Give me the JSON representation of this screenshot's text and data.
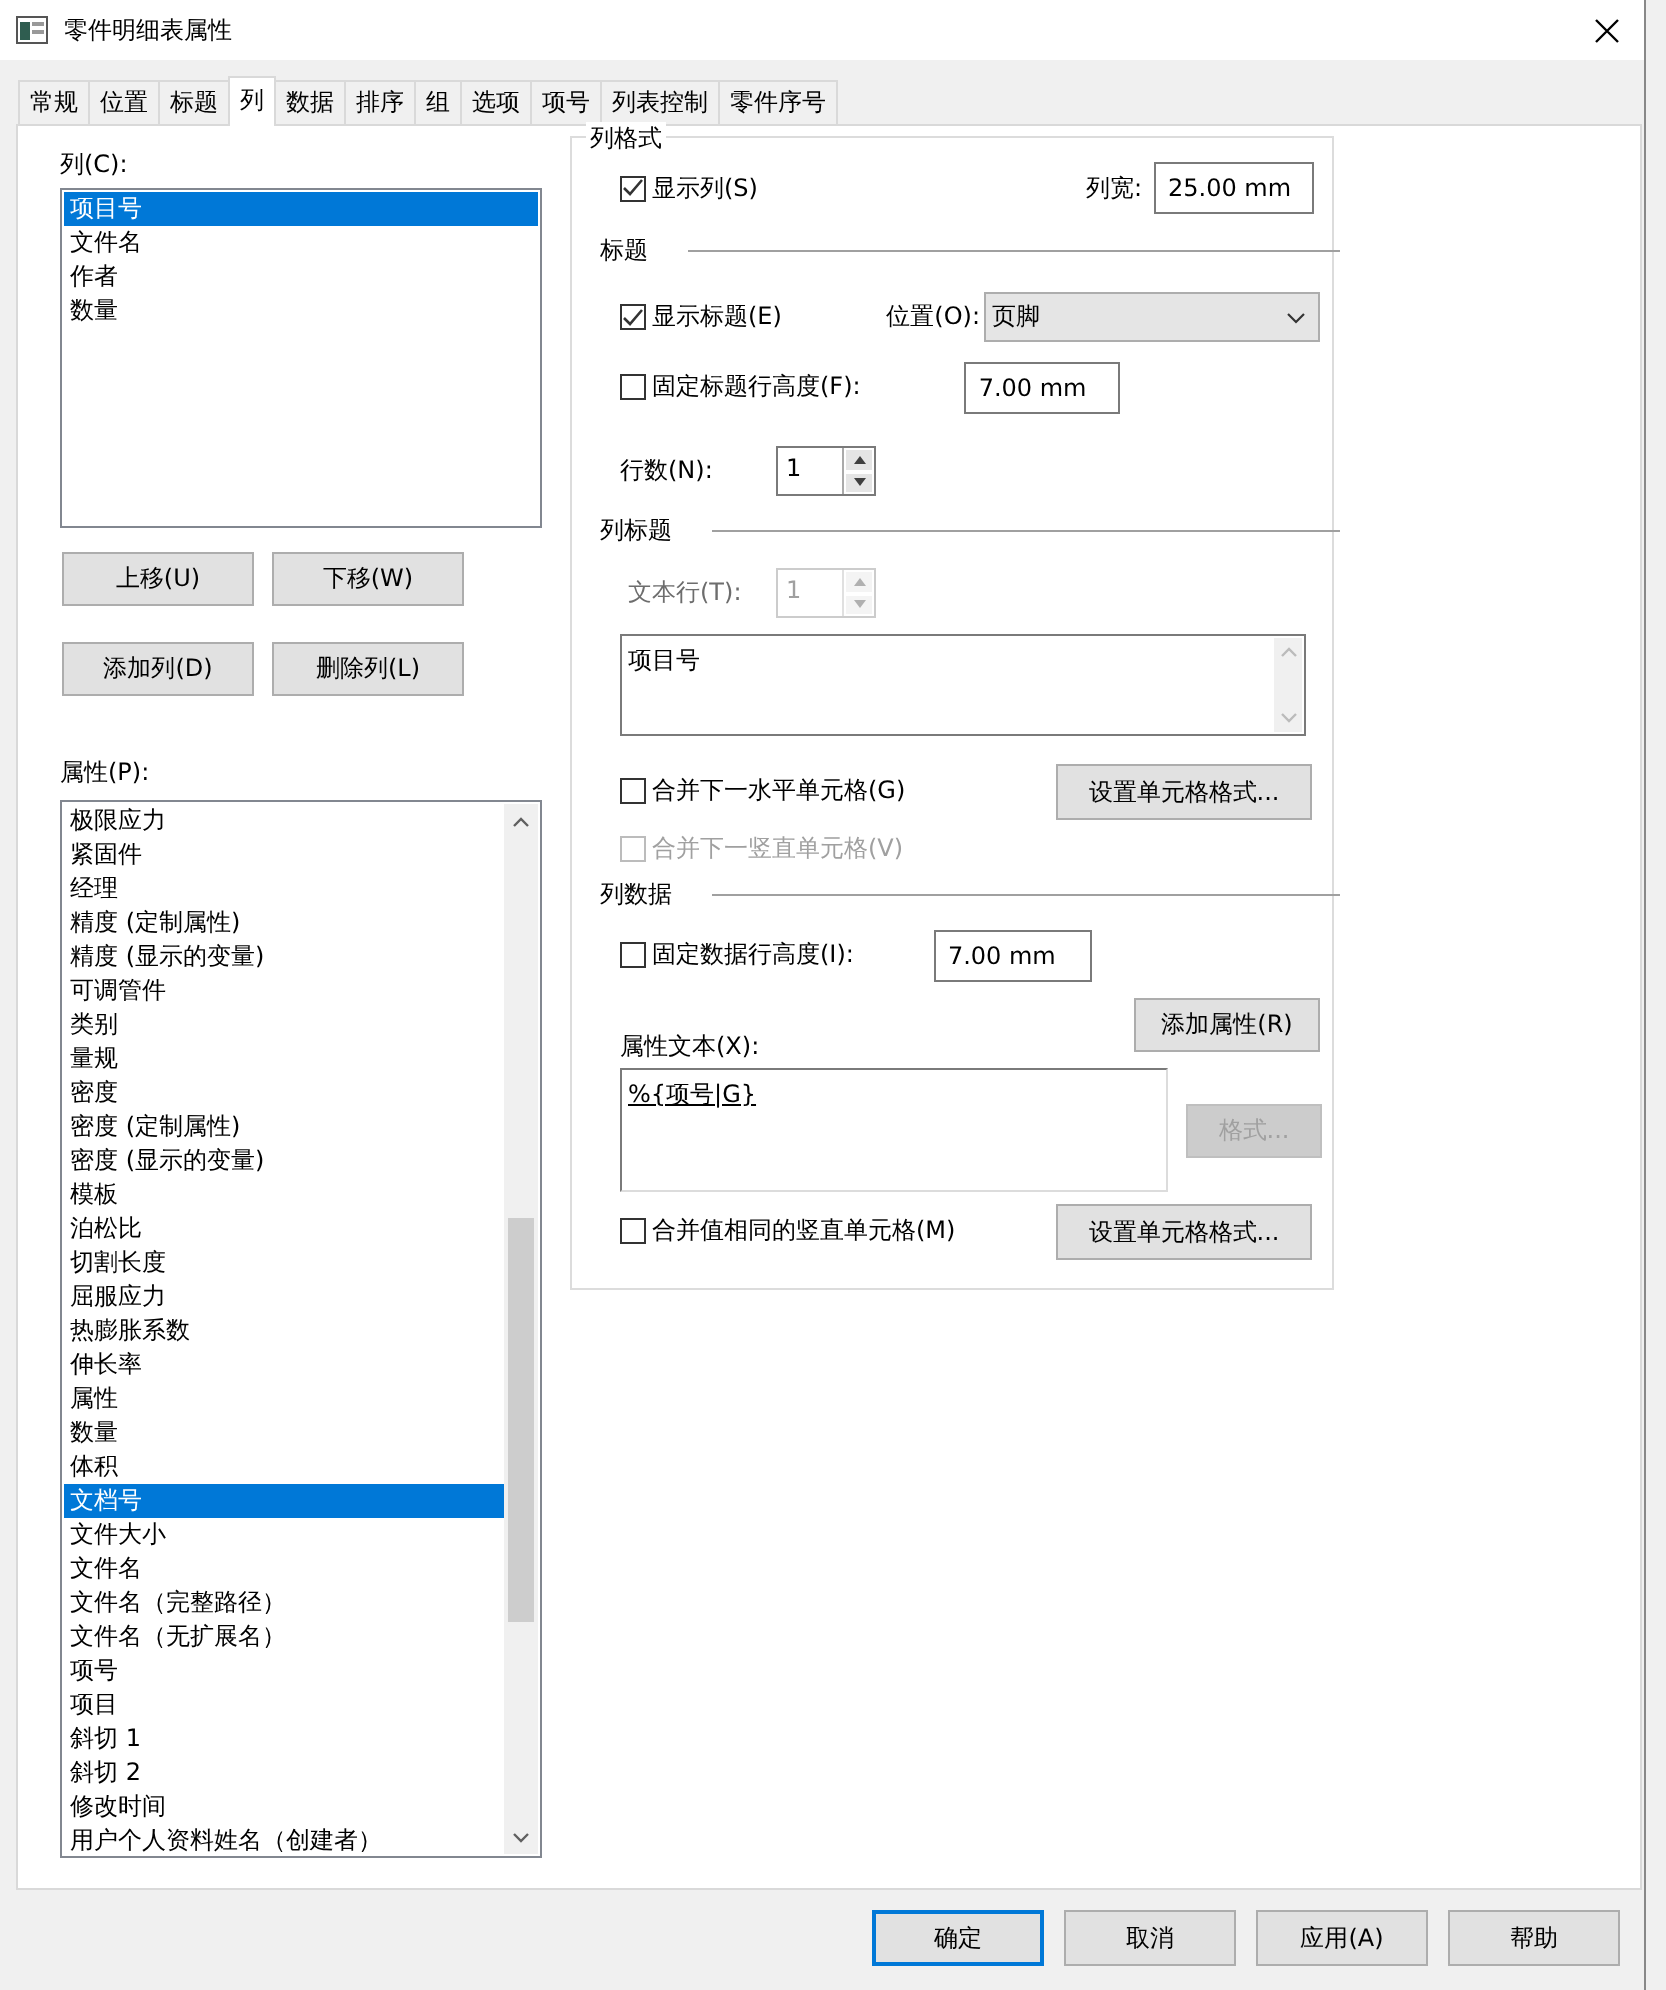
{
  "window": {
    "title": "零件明细表属性"
  },
  "tabs": [
    {
      "label": "常规",
      "selected": false
    },
    {
      "label": "位置",
      "selected": false
    },
    {
      "label": "标题",
      "selected": false
    },
    {
      "label": "列",
      "selected": true
    },
    {
      "label": "数据",
      "selected": false
    },
    {
      "label": "排序",
      "selected": false
    },
    {
      "label": "组",
      "selected": false
    },
    {
      "label": "选项",
      "selected": false
    },
    {
      "label": "项号",
      "selected": false
    },
    {
      "label": "列表控制",
      "selected": false
    },
    {
      "label": "零件序号",
      "selected": false
    }
  ],
  "columns_list": {
    "label": "列(C):",
    "items": [
      {
        "label": "项目号",
        "selected": true
      },
      {
        "label": "文件名",
        "selected": false
      },
      {
        "label": "作者",
        "selected": false
      },
      {
        "label": "数量",
        "selected": false
      }
    ]
  },
  "column_buttons": [
    "上移(U)",
    "下移(W)",
    "添加列(D)",
    "删除列(L)"
  ],
  "properties_list": {
    "label": "属性(P):",
    "items": [
      {
        "label": "极限应力",
        "selected": false
      },
      {
        "label": "紧固件",
        "selected": false
      },
      {
        "label": "经理",
        "selected": false
      },
      {
        "label": "精度 (定制属性)",
        "selected": false
      },
      {
        "label": "精度 (显示的变量)",
        "selected": false
      },
      {
        "label": "可调管件",
        "selected": false
      },
      {
        "label": "类别",
        "selected": false
      },
      {
        "label": "量规",
        "selected": false
      },
      {
        "label": "密度",
        "selected": false
      },
      {
        "label": "密度 (定制属性)",
        "selected": false
      },
      {
        "label": "密度 (显示的变量)",
        "selected": false
      },
      {
        "label": "模板",
        "selected": false
      },
      {
        "label": "泊松比",
        "selected": false
      },
      {
        "label": "切割长度",
        "selected": false
      },
      {
        "label": "屈服应力",
        "selected": false
      },
      {
        "label": "热膨胀系数",
        "selected": false
      },
      {
        "label": "伸长率",
        "selected": false
      },
      {
        "label": "属性",
        "selected": false
      },
      {
        "label": "数量",
        "selected": false
      },
      {
        "label": "体积",
        "selected": false
      },
      {
        "label": "文档号",
        "selected": true
      },
      {
        "label": "文件大小",
        "selected": false
      },
      {
        "label": "文件名",
        "selected": false
      },
      {
        "label": "文件名（完整路径）",
        "selected": false
      },
      {
        "label": "文件名（无扩展名）",
        "selected": false
      },
      {
        "label": "项号",
        "selected": false
      },
      {
        "label": "项目",
        "selected": false
      },
      {
        "label": "斜切 1",
        "selected": false
      },
      {
        "label": "斜切 2",
        "selected": false
      },
      {
        "label": "修改时间",
        "selected": false
      },
      {
        "label": "用户个人资料姓名（创建者）",
        "selected": false
      }
    ]
  },
  "column_format": {
    "title": "列格式",
    "show_column": {
      "label": "显示列(S)",
      "checked": true,
      "disabled": false
    },
    "width_label": "列宽:",
    "width_value": "25.00 mm",
    "heading_section": "标题",
    "show_heading": {
      "label": "显示标题(E)",
      "checked": true,
      "disabled": false
    },
    "position_label": "位置(O):",
    "position_value": "页脚",
    "fixed_heading_height": {
      "label": "固定标题行高度(F):",
      "checked": false,
      "disabled": false
    },
    "heading_height_value": "7.00 mm",
    "rows_label": "行数(N):",
    "rows_value": "1",
    "rows_disabled": false,
    "column_heading_section": "列标题",
    "text_row_label": "文本行(T):",
    "text_row_value": "1",
    "text_row_disabled": true,
    "heading_text": "项目号",
    "merge_horizontal": {
      "label": "合并下一水平单元格(G)",
      "checked": false,
      "disabled": false
    },
    "format_cells_button": "设置单元格格式...",
    "merge_vertical": {
      "label": "合并下一竖直单元格(V)",
      "checked": false,
      "disabled": true
    },
    "column_data_section": "列数据",
    "fixed_data_height": {
      "label": "固定数据行高度(I):",
      "checked": false,
      "disabled": false
    },
    "data_height_value": "7.00 mm",
    "property_text_label": "属性文本(X):",
    "add_property_button": "添加属性(R)",
    "property_text": "%{项号|G}",
    "format_button": {
      "label": "格式...",
      "disabled": true
    },
    "merge_same": {
      "label": "合并值相同的竖直单元格(M)",
      "checked": false,
      "disabled": false
    },
    "format_cells_button_2": "设置单元格格式..."
  },
  "buttons": [
    {
      "label": "确定",
      "default": true
    },
    {
      "label": "取消",
      "default": false
    },
    {
      "label": "应用(A)",
      "default": false
    },
    {
      "label": "帮助",
      "default": false
    }
  ]
}
